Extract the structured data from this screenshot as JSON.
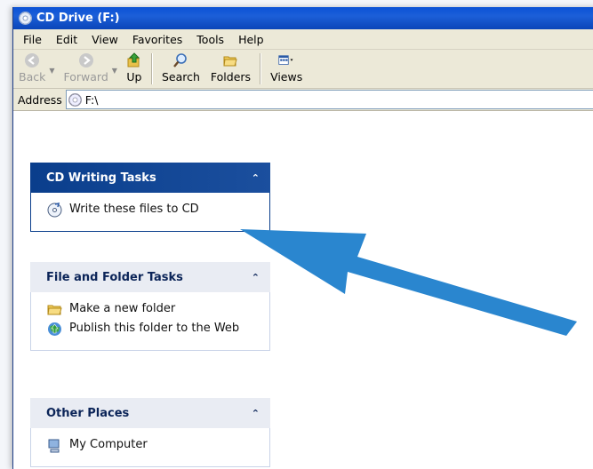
{
  "window": {
    "title": "CD Drive (F:)"
  },
  "menu": [
    "File",
    "Edit",
    "View",
    "Favorites",
    "Tools",
    "Help"
  ],
  "toolbar": {
    "back": "Back",
    "forward": "Forward",
    "up": "Up",
    "search": "Search",
    "folders": "Folders",
    "views": "Views"
  },
  "address": {
    "label": "Address",
    "value": "F:\\"
  },
  "panels": {
    "cd_writing": {
      "title": "CD Writing Tasks",
      "items": [
        "Write these files to CD"
      ]
    },
    "file_folder": {
      "title": "File and Folder Tasks",
      "items": [
        "Make a new folder",
        "Publish this folder to the Web"
      ]
    },
    "other_places": {
      "title": "Other Places",
      "items": [
        "My Computer"
      ]
    }
  },
  "colors": {
    "arrow": "#2a86cf",
    "panel_header_blue": "#0a3e8c",
    "title_bar": "#0b52d6"
  }
}
